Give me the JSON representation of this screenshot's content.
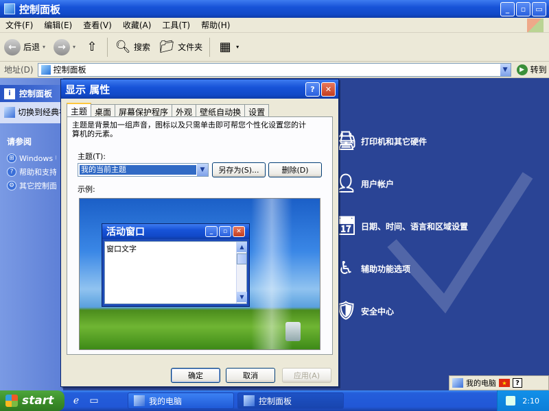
{
  "window": {
    "title": "控制面板",
    "menu": [
      "文件(F)",
      "编辑(E)",
      "查看(V)",
      "收藏(A)",
      "工具(T)",
      "帮助(H)"
    ],
    "toolbar": {
      "back_label": "后退",
      "search_label": "搜索",
      "folders_label": "文件夹"
    },
    "address": {
      "label": "地址(D)",
      "value": "控制面板",
      "go_label": "转到"
    }
  },
  "sidebar": {
    "panel_title": "控制面板",
    "switch_view": "切换到经典视图",
    "see_also_title": "请参阅",
    "links": [
      "Windows Update",
      "帮助和支持",
      "其它控制面板选项"
    ]
  },
  "categories": [
    {
      "label": "打印机和其它硬件",
      "icon": "printer-icon"
    },
    {
      "label": "用户帐户",
      "icon": "user-icon"
    },
    {
      "label": "日期、时间、语言和区域设置",
      "icon": "calendar-icon"
    },
    {
      "label": "辅助功能选项",
      "icon": "accessibility-icon"
    },
    {
      "label": "安全中心",
      "icon": "shield-icon"
    }
  ],
  "dialog": {
    "title": "显示 属性",
    "tabs": [
      "主题",
      "桌面",
      "屏幕保护程序",
      "外观",
      "壁纸自动换",
      "设置"
    ],
    "active_tab": "主题",
    "description": "主题是背景加一组声音，图标以及只需单击即可帮您个性化设置您的计算机的元素。",
    "theme_label": "主题(T):",
    "theme_value": "我的当前主题",
    "save_as_label": "另存为(S)...",
    "delete_label": "删除(D)",
    "sample_label": "示例:",
    "preview_window_title": "活动窗口",
    "preview_window_text": "窗口文字",
    "ok_label": "确定",
    "cancel_label": "取消",
    "apply_label": "应用(A)"
  },
  "taskbar": {
    "start_label": "start",
    "tasks": [
      "我的电脑",
      "控制面板"
    ],
    "clock": "2:10"
  },
  "langbar": {
    "label": "我的电脑"
  }
}
